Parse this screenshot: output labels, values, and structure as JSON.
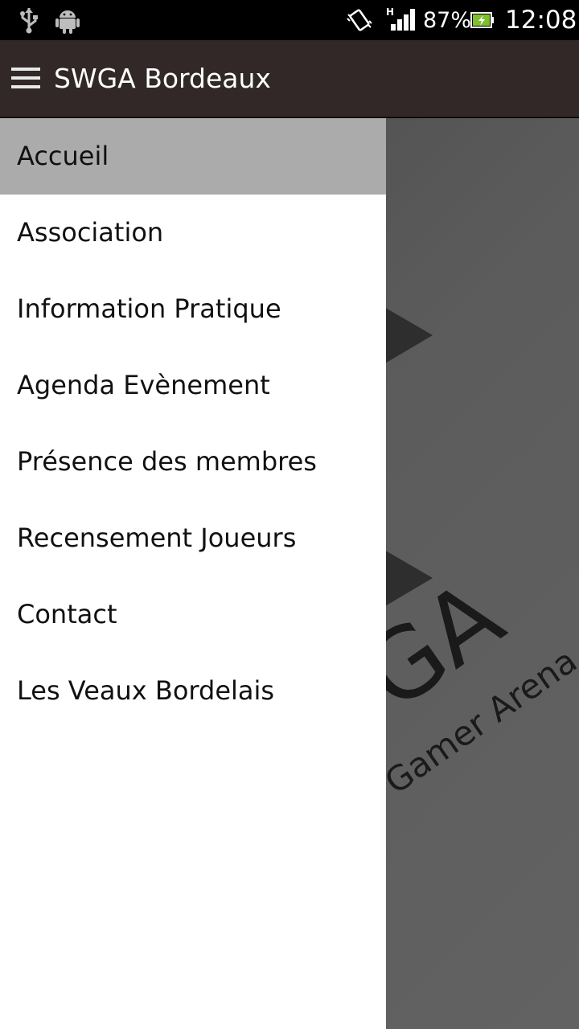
{
  "status_bar": {
    "left_icons": [
      "usb-icon",
      "android-icon"
    ],
    "right_icons": [
      "vibrate-icon",
      "signal-icon",
      "battery-icon"
    ],
    "network_type": "H",
    "battery_percent": "87%",
    "time": "12:08"
  },
  "action_bar": {
    "title": "SWGA Bordeaux",
    "nav_icon": "menu-icon"
  },
  "drawer": {
    "items": [
      {
        "label": "Accueil",
        "active": true
      },
      {
        "label": "Association"
      },
      {
        "label": "Information Pratique"
      },
      {
        "label": "Agenda Evènement"
      },
      {
        "label": "Présence des membres"
      },
      {
        "label": "Recensement Joueurs"
      },
      {
        "label": "Contact"
      },
      {
        "label": "Les Veaux Bordelais"
      }
    ]
  },
  "background": {
    "logo_letters": "GA",
    "logo_tagline": "Gamer Arena"
  },
  "colors": {
    "status_bar": "#000000",
    "action_bar": "#322828",
    "drawer": "#ffffff",
    "active_item": "#ababab",
    "content_background": "#5c5c5c"
  }
}
